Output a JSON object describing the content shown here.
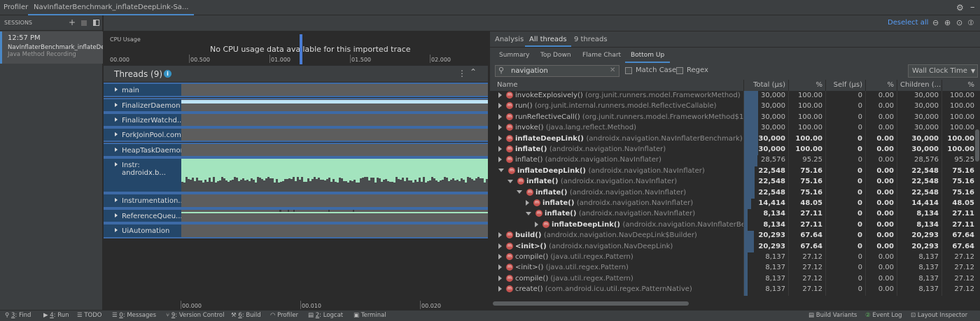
{
  "topbar": {
    "profiler_label": "Profiler",
    "tab_title": "NavInflaterBenchmark_inflateDeepLink-Sa..."
  },
  "sessions": {
    "header": "SESSIONS",
    "time": "12:57 PM",
    "name": "NavInflaterBenchmark_inflateDee...",
    "type": "Java Method Recording"
  },
  "cpu": {
    "label": "CPU Usage",
    "message": "No CPU usage data available for this imported trace",
    "ticks": [
      "00.000",
      "00.500",
      "01.000",
      "01.500",
      "02.000"
    ]
  },
  "threads": {
    "title": "Threads (9)",
    "items": [
      "main",
      "FinalizerDaemon",
      "FinalizerWatchd...",
      "ForkJoinPool.com...",
      "HeapTaskDaemon",
      "Instr: androidx.b...",
      "Instrumentation...",
      "ReferenceQueu...",
      "UiAutomation"
    ]
  },
  "timeline_bottom": [
    "00.000",
    "00.010",
    "00.020"
  ],
  "right": {
    "deselect": "Deselect all",
    "tabs": [
      "Analysis",
      "All threads",
      "9 threads"
    ],
    "subtabs": [
      "Summary",
      "Top Down",
      "Flame Chart",
      "Bottom Up"
    ],
    "search_value": "navigation",
    "match_case": "Match Case",
    "regex": "Regex",
    "clock": "Wall Clock Time",
    "headers": [
      "Name",
      "Total (μs)",
      "%",
      "Self (μs)",
      "%",
      "Children (...",
      "%"
    ],
    "rows": [
      {
        "indent": 0,
        "exp": "c",
        "fn": "invokeExplosively()",
        "pkg": "(org.junit.runners.model.FrameworkMethod)",
        "total": "30,000",
        "tp": "100.00",
        "self": "0",
        "sp": "0.00",
        "child": "30,000",
        "cp": "100.00",
        "bold": false,
        "bar": 1.0
      },
      {
        "indent": 0,
        "exp": "c",
        "fn": "run()",
        "pkg": "(org.junit.internal.runners.model.ReflectiveCallable)",
        "total": "30,000",
        "tp": "100.00",
        "self": "0",
        "sp": "0.00",
        "child": "30,000",
        "cp": "100.00",
        "bold": false,
        "bar": 1.0
      },
      {
        "indent": 0,
        "exp": "c",
        "fn": "runReflectiveCall()",
        "pkg": "(org.junit.runners.model.FrameworkMethod$1)",
        "total": "30,000",
        "tp": "100.00",
        "self": "0",
        "sp": "0.00",
        "child": "30,000",
        "cp": "100.00",
        "bold": false,
        "bar": 1.0
      },
      {
        "indent": 0,
        "exp": "c",
        "fn": "invoke()",
        "pkg": "(java.lang.reflect.Method)",
        "total": "30,000",
        "tp": "100.00",
        "self": "0",
        "sp": "0.00",
        "child": "30,000",
        "cp": "100.00",
        "bold": false,
        "bar": 1.0
      },
      {
        "indent": 0,
        "exp": "c",
        "fn": "inflateDeepLink()",
        "pkg": "(androidx.navigation.NavInflaterBenchmark)",
        "total": "30,000",
        "tp": "100.00",
        "self": "0",
        "sp": "0.00",
        "child": "30,000",
        "cp": "100.00",
        "bold": true,
        "bar": 1.0
      },
      {
        "indent": 0,
        "exp": "c",
        "fn": "inflate()",
        "pkg": "(androidx.navigation.NavInflater)",
        "total": "30,000",
        "tp": "100.00",
        "self": "0",
        "sp": "0.00",
        "child": "30,000",
        "cp": "100.00",
        "bold": true,
        "bar": 1.0
      },
      {
        "indent": 0,
        "exp": "c",
        "fn": "inflate()",
        "pkg": "(androidx.navigation.NavInflater)",
        "total": "28,576",
        "tp": "95.25",
        "self": "0",
        "sp": "0.00",
        "child": "28,576",
        "cp": "95.25",
        "bold": false,
        "bar": 0.95
      },
      {
        "indent": 0,
        "exp": "o",
        "fn": "inflateDeepLink()",
        "pkg": "(androidx.navigation.NavInflater)",
        "total": "22,548",
        "tp": "75.16",
        "self": "0",
        "sp": "0.00",
        "child": "22,548",
        "cp": "75.16",
        "bold": true,
        "bar": 0.75
      },
      {
        "indent": 1,
        "exp": "o",
        "fn": "inflate()",
        "pkg": "(androidx.navigation.NavInflater)",
        "total": "22,548",
        "tp": "75.16",
        "self": "0",
        "sp": "0.00",
        "child": "22,548",
        "cp": "75.16",
        "bold": true,
        "bar": 0.75
      },
      {
        "indent": 2,
        "exp": "o",
        "fn": "inflate()",
        "pkg": "(androidx.navigation.NavInflater)",
        "total": "22,548",
        "tp": "75.16",
        "self": "0",
        "sp": "0.00",
        "child": "22,548",
        "cp": "75.16",
        "bold": true,
        "bar": 0.75
      },
      {
        "indent": 3,
        "exp": "c",
        "fn": "inflate()",
        "pkg": "(androidx.navigation.NavInflater)",
        "total": "14,414",
        "tp": "48.05",
        "self": "0",
        "sp": "0.00",
        "child": "14,414",
        "cp": "48.05",
        "bold": true,
        "bar": 0.48
      },
      {
        "indent": 3,
        "exp": "o",
        "fn": "inflate()",
        "pkg": "(androidx.navigation.NavInflater)",
        "total": "8,134",
        "tp": "27.11",
        "self": "0",
        "sp": "0.00",
        "child": "8,134",
        "cp": "27.11",
        "bold": true,
        "bar": 0.27
      },
      {
        "indent": 4,
        "exp": "c",
        "fn": "inflateDeepLink()",
        "pkg": "(androidx.navigation.NavInflaterBenchm",
        "total": "8,134",
        "tp": "27.11",
        "self": "0",
        "sp": "0.00",
        "child": "8,134",
        "cp": "27.11",
        "bold": true,
        "bar": 0.27
      },
      {
        "indent": 0,
        "exp": "c",
        "fn": "build()",
        "pkg": "(androidx.navigation.NavDeepLink$Builder)",
        "total": "20,293",
        "tp": "67.64",
        "self": "0",
        "sp": "0.00",
        "child": "20,293",
        "cp": "67.64",
        "bold": true,
        "bar": 0.68
      },
      {
        "indent": 0,
        "exp": "c",
        "fn": "<init>()",
        "pkg": "(androidx.navigation.NavDeepLink)",
        "total": "20,293",
        "tp": "67.64",
        "self": "0",
        "sp": "0.00",
        "child": "20,293",
        "cp": "67.64",
        "bold": true,
        "bar": 0.68
      },
      {
        "indent": 0,
        "exp": "c",
        "fn": "compile()",
        "pkg": "(java.util.regex.Pattern)",
        "total": "8,137",
        "tp": "27.12",
        "self": "0",
        "sp": "0.00",
        "child": "8,137",
        "cp": "27.12",
        "bold": false,
        "bar": 0.27
      },
      {
        "indent": 0,
        "exp": "c",
        "fn": "<init>()",
        "pkg": "(java.util.regex.Pattern)",
        "total": "8,137",
        "tp": "27.12",
        "self": "0",
        "sp": "0.00",
        "child": "8,137",
        "cp": "27.12",
        "bold": false,
        "bar": 0.27
      },
      {
        "indent": 0,
        "exp": "c",
        "fn": "compile()",
        "pkg": "(java.util.regex.Pattern)",
        "total": "8,137",
        "tp": "27.12",
        "self": "0",
        "sp": "0.00",
        "child": "8,137",
        "cp": "27.12",
        "bold": false,
        "bar": 0.27
      },
      {
        "indent": 0,
        "exp": "c",
        "fn": "create()",
        "pkg": "(com.android.icu.util.regex.PatternNative)",
        "total": "8,137",
        "tp": "27.12",
        "self": "0",
        "sp": "0.00",
        "child": "8,137",
        "cp": "27.12",
        "bold": false,
        "bar": 0.27
      }
    ]
  },
  "status": [
    {
      "icon": "search-icon",
      "num": "3",
      "label": "Find"
    },
    {
      "icon": "play-icon",
      "num": "4",
      "label": "Run"
    },
    {
      "icon": "list-icon",
      "num": "",
      "label": "TODO"
    },
    {
      "icon": "message-icon",
      "num": "0",
      "label": "Messages"
    },
    {
      "icon": "branch-icon",
      "num": "9",
      "label": "Version Control"
    },
    {
      "icon": "build-icon",
      "num": "6",
      "label": "Build"
    },
    {
      "icon": "gauge-icon",
      "num": "",
      "label": "Profiler"
    },
    {
      "icon": "logcat-icon",
      "num": "2",
      "label": "Logcat"
    },
    {
      "icon": "terminal-icon",
      "num": "",
      "label": "Terminal"
    }
  ],
  "status_right": [
    "Build Variants",
    "Event Log",
    "Layout Inspector"
  ],
  "colors": {
    "accent": "#4a88c7",
    "method_icon": "#c75450",
    "thread_label_bg": "#24476a",
    "thread_graph_bg": "#5d5d5d",
    "instr_graph": "#a3e4be"
  }
}
